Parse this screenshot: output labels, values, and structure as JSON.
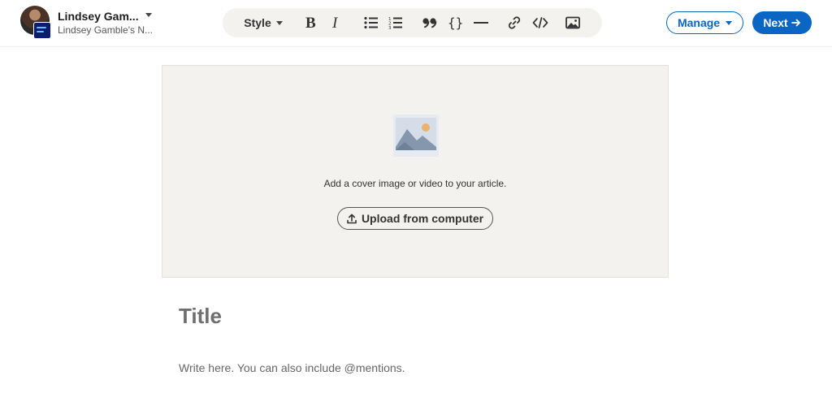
{
  "author": {
    "name": "Lindsey Gam...",
    "publication": "Lindsey Gamble's N..."
  },
  "toolbar": {
    "style_label": "Style",
    "icons": [
      "bold-icon",
      "italic-icon",
      "bulleted-list-icon",
      "numbered-list-icon",
      "quote-icon",
      "code-block-icon",
      "divider-icon",
      "link-icon",
      "embed-code-icon",
      "image-icon"
    ]
  },
  "actions": {
    "manage_label": "Manage",
    "next_label": "Next"
  },
  "cover": {
    "prompt": "Add a cover image or video to your article.",
    "upload_label": "Upload from computer"
  },
  "editor": {
    "title_placeholder": "Title",
    "body_placeholder": "Write here. You can also include @mentions."
  },
  "colors": {
    "accent": "#0a66c2",
    "toolbar_bg": "#f3f2ef",
    "cover_bg": "#f3f2ef"
  }
}
